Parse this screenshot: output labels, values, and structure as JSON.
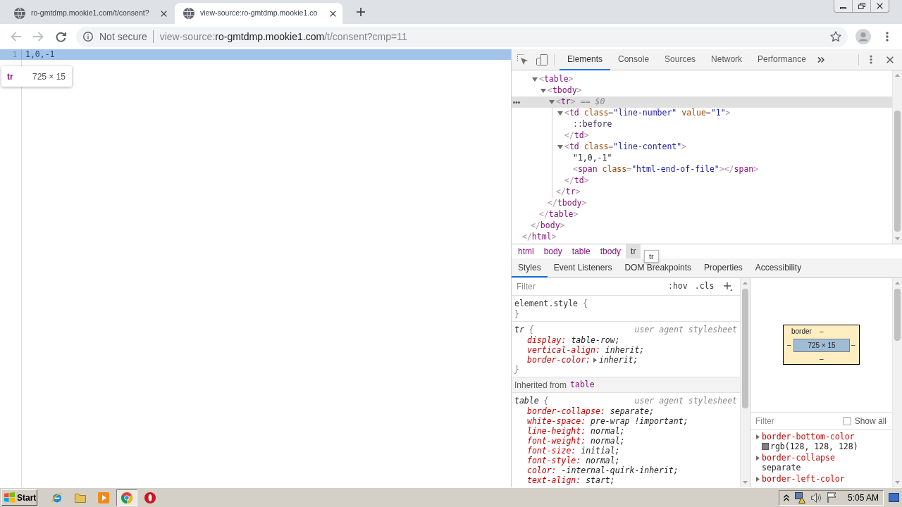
{
  "browser": {
    "tabs": [
      {
        "title": "ro-gmtdmp.mookie1.com/t/consent?",
        "selected": false
      },
      {
        "title": "view-source:ro-gmtdmp.mookie1.co",
        "selected": true
      }
    ],
    "nav_buttons": [
      {
        "kind": "back",
        "disabled": true
      },
      {
        "kind": "forward",
        "disabled": true
      },
      {
        "kind": "reload",
        "disabled": false
      }
    ],
    "address": {
      "security": "Not secure",
      "url": [
        {
          "text": "view-source:",
          "emphasis": false
        },
        {
          "text": "ro-gmtdmp.mookie1.com",
          "emphasis": true
        },
        {
          "text": "/t/consent?cmp=11",
          "emphasis": false
        }
      ]
    }
  },
  "page": {
    "lines": [
      {
        "number": "1",
        "text": "1,0,-1",
        "highlighted": true
      }
    ],
    "tooltip": {
      "tag": "tr",
      "size": "725 × 15"
    }
  },
  "devtools": {
    "tabs": [
      {
        "label": "Elements",
        "selected": true
      },
      {
        "label": "Console",
        "selected": false
      },
      {
        "label": "Sources",
        "selected": false
      },
      {
        "label": "Network",
        "selected": false
      },
      {
        "label": "Performance",
        "selected": false
      }
    ],
    "dom_tree": [
      {
        "kind": "scrolled",
        "close": [
          {
            "kind": "punct",
            "text": "</"
          },
          {
            "kind": "tag",
            "text": "html"
          },
          {
            "kind": "punct",
            "text": ">"
          }
        ],
        "children": [
          {
            "kind": "scrolled",
            "close": [
              {
                "kind": "punct",
                "text": "</"
              },
              {
                "kind": "tag",
                "text": "body"
              },
              {
                "kind": "punct",
                "text": ">"
              }
            ],
            "children": [
              {
                "kind": "container",
                "expanded": true,
                "selected": false,
                "open": [
                  {
                    "kind": "punct",
                    "text": "<"
                  },
                  {
                    "kind": "tag",
                    "text": "table"
                  },
                  {
                    "kind": "punct",
                    "text": ">"
                  }
                ],
                "close": [
                  {
                    "kind": "punct",
                    "text": "</"
                  },
                  {
                    "kind": "tag",
                    "text": "table"
                  },
                  {
                    "kind": "punct",
                    "text": ">"
                  }
                ],
                "children": [
                  {
                    "kind": "container",
                    "expanded": true,
                    "selected": false,
                    "open": [
                      {
                        "kind": "punct",
                        "text": "<"
                      },
                      {
                        "kind": "tag",
                        "text": "tbody"
                      },
                      {
                        "kind": "punct",
                        "text": ">"
                      }
                    ],
                    "close": [
                      {
                        "kind": "punct",
                        "text": "</"
                      },
                      {
                        "kind": "tag",
                        "text": "tbody"
                      },
                      {
                        "kind": "punct",
                        "text": ">"
                      }
                    ],
                    "children": [
                      {
                        "kind": "container",
                        "expanded": true,
                        "selected": true,
                        "suffix": "== $0",
                        "open": [
                          {
                            "kind": "punct",
                            "text": "<"
                          },
                          {
                            "kind": "tag",
                            "text": "tr"
                          },
                          {
                            "kind": "punct",
                            "text": ">"
                          }
                        ],
                        "close": [
                          {
                            "kind": "punct",
                            "text": "</"
                          },
                          {
                            "kind": "tag",
                            "text": "tr"
                          },
                          {
                            "kind": "punct",
                            "text": ">"
                          }
                        ],
                        "children": [
                          {
                            "kind": "container",
                            "expanded": true,
                            "selected": false,
                            "open": [
                              {
                                "kind": "punct",
                                "text": "<"
                              },
                              {
                                "kind": "tag",
                                "text": "td"
                              },
                              {
                                "kind": "attr",
                                "text": " class"
                              },
                              {
                                "kind": "punct",
                                "text": "="
                              },
                              {
                                "kind": "value",
                                "text": "\"line-number\""
                              },
                              {
                                "kind": "attr",
                                "text": " value"
                              },
                              {
                                "kind": "punct",
                                "text": "="
                              },
                              {
                                "kind": "value",
                                "text": "\"1\""
                              },
                              {
                                "kind": "punct",
                                "text": ">"
                              }
                            ],
                            "close": [
                              {
                                "kind": "punct",
                                "text": "</"
                              },
                              {
                                "kind": "tag",
                                "text": "td"
                              },
                              {
                                "kind": "punct",
                                "text": ">"
                              }
                            ],
                            "children": [
                              {
                                "kind": "leaf",
                                "selected": false,
                                "open": [
                                  {
                                    "kind": "pseudo",
                                    "text": "::before"
                                  }
                                ]
                              }
                            ]
                          },
                          {
                            "kind": "container",
                            "expanded": true,
                            "selected": false,
                            "open": [
                              {
                                "kind": "punct",
                                "text": "<"
                              },
                              {
                                "kind": "tag",
                                "text": "td"
                              },
                              {
                                "kind": "attr",
                                "text": " class"
                              },
                              {
                                "kind": "punct",
                                "text": "="
                              },
                              {
                                "kind": "value",
                                "text": "\"line-content\""
                              },
                              {
                                "kind": "punct",
                                "text": ">"
                              }
                            ],
                            "close": [
                              {
                                "kind": "punct",
                                "text": "</"
                              },
                              {
                                "kind": "tag",
                                "text": "td"
                              },
                              {
                                "kind": "punct",
                                "text": ">"
                              }
                            ],
                            "children": [
                              {
                                "kind": "leaf",
                                "selected": false,
                                "open": [
                                  {
                                    "kind": "text",
                                    "text": "\"1,0,-1\""
                                  }
                                ]
                              },
                              {
                                "kind": "leaf",
                                "selected": false,
                                "open": [
                                  {
                                    "kind": "punct",
                                    "text": "<"
                                  },
                                  {
                                    "kind": "tag",
                                    "text": "span"
                                  },
                                  {
                                    "kind": "attr",
                                    "text": " class"
                                  },
                                  {
                                    "kind": "punct",
                                    "text": "="
                                  },
                                  {
                                    "kind": "value",
                                    "text": "\"html-end-of-file\""
                                  },
                                  {
                                    "kind": "punct",
                                    "text": "></"
                                  },
                                  {
                                    "kind": "tag",
                                    "text": "span"
                                  },
                                  {
                                    "kind": "punct",
                                    "text": ">"
                                  }
                                ]
                              }
                            ]
                          }
                        ]
                      }
                    ]
                  }
                ]
              }
            ]
          }
        ]
      }
    ],
    "breadcrumbs": [
      {
        "label": "html",
        "selected": false
      },
      {
        "label": "body",
        "selected": false
      },
      {
        "label": "table",
        "selected": false
      },
      {
        "label": "tbody",
        "selected": false
      },
      {
        "label": "tr",
        "selected": true
      }
    ],
    "breadcrumb_tooltip": "tr",
    "sidebar_tabs": [
      {
        "label": "Styles",
        "selected": true
      },
      {
        "label": "Event Listeners",
        "selected": false
      },
      {
        "label": "DOM Breakpoints",
        "selected": false
      },
      {
        "label": "Properties",
        "selected": false
      },
      {
        "label": "Accessibility",
        "selected": false
      }
    ],
    "styles": {
      "filter": {
        "placeholder": "Filter"
      },
      "toggles": [
        ":hov",
        ".cls"
      ],
      "sections": [
        {
          "kind": "rule",
          "selector": "element.style",
          "open_brace": "{",
          "close_brace": "}"
        },
        {
          "kind": "rule",
          "selector": "tr",
          "open_brace": "{",
          "close_brace": "}",
          "source": "user agent stylesheet",
          "properties": [
            {
              "name": "display:",
              "value": "table-row;",
              "expandable": false
            },
            {
              "name": "vertical-align:",
              "value": "inherit;",
              "expandable": false
            },
            {
              "name": "border-color:",
              "value": "inherit;",
              "expandable": true
            }
          ]
        },
        {
          "kind": "inherited",
          "label": "Inherited from",
          "selector": "table"
        },
        {
          "kind": "rule",
          "selector": "table",
          "open_brace": "{",
          "source": "user agent stylesheet",
          "properties": [
            {
              "name": "border-collapse:",
              "value": "separate;",
              "expandable": false
            },
            {
              "name": "white-space:",
              "value": "pre-wrap !important;",
              "expandable": false
            },
            {
              "name": "line-height:",
              "value": "normal;",
              "expandable": false
            },
            {
              "name": "font-weight:",
              "value": "normal;",
              "expandable": false
            },
            {
              "name": "font-size:",
              "value": "initial;",
              "expandable": false
            },
            {
              "name": "font-style:",
              "value": "normal;",
              "expandable": false
            },
            {
              "name": "color:",
              "value": "-internal-quirk-inherit;",
              "expandable": false
            },
            {
              "name": "text-align:",
              "value": "start;",
              "expandable": false
            }
          ]
        }
      ]
    },
    "box_model": {
      "label": "border",
      "top": "–",
      "right": "–",
      "bottom": "–",
      "left": "–",
      "content": "725 × 15"
    },
    "computed": {
      "filter": {
        "placeholder": "Filter"
      },
      "show_all": {
        "label": "Show all",
        "checked": false
      },
      "properties": [
        {
          "name": "border-bottom-color",
          "value": "rgb(128, 128, 128)",
          "color": "#808080"
        },
        {
          "name": "border-collapse",
          "value": "separate"
        },
        {
          "name": "border-left-color"
        }
      ]
    }
  },
  "taskbar": {
    "start": {
      "label": "Start"
    },
    "apps": [
      {
        "kind": "ie",
        "selected": false
      },
      {
        "kind": "explorer",
        "selected": false
      },
      {
        "kind": "media",
        "selected": false
      },
      {
        "kind": "chrome",
        "selected": true
      },
      {
        "kind": "opera",
        "selected": false
      }
    ],
    "clock": "5:05 AM"
  }
}
